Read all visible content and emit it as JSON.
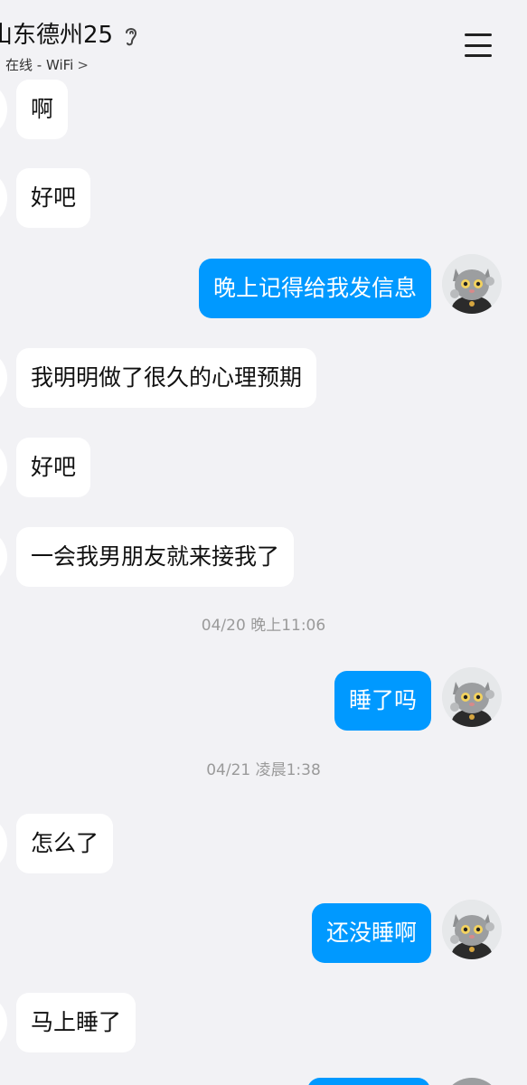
{
  "header": {
    "title": "山东德州25",
    "status": "在线 - WiFi",
    "status_chevron": ">",
    "ear_icon": "ear-icon",
    "menu_icon": "hamburger-menu-icon"
  },
  "colors": {
    "outgoing_bubble": "#0099ff",
    "incoming_bubble": "#ffffff",
    "background": "#f2f2f5"
  },
  "messages": [
    {
      "dir": "in",
      "text": "啊"
    },
    {
      "dir": "in",
      "text": "好吧"
    },
    {
      "dir": "out",
      "text": "晚上记得给我发信息"
    },
    {
      "dir": "in",
      "text": "我明明做了很久的心理预期"
    },
    {
      "dir": "in",
      "text": "好吧"
    },
    {
      "dir": "in",
      "text": "一会我男朋友就来接我了"
    },
    {
      "dir": "out",
      "text": "睡了吗"
    },
    {
      "dir": "in",
      "text": "怎么了"
    },
    {
      "dir": "out",
      "text": "还没睡啊"
    },
    {
      "dir": "in",
      "text": "马上睡了"
    }
  ],
  "timestamps": [
    {
      "text": "04/20 晚上11:06"
    },
    {
      "text": "04/21 凌晨1:38"
    }
  ]
}
